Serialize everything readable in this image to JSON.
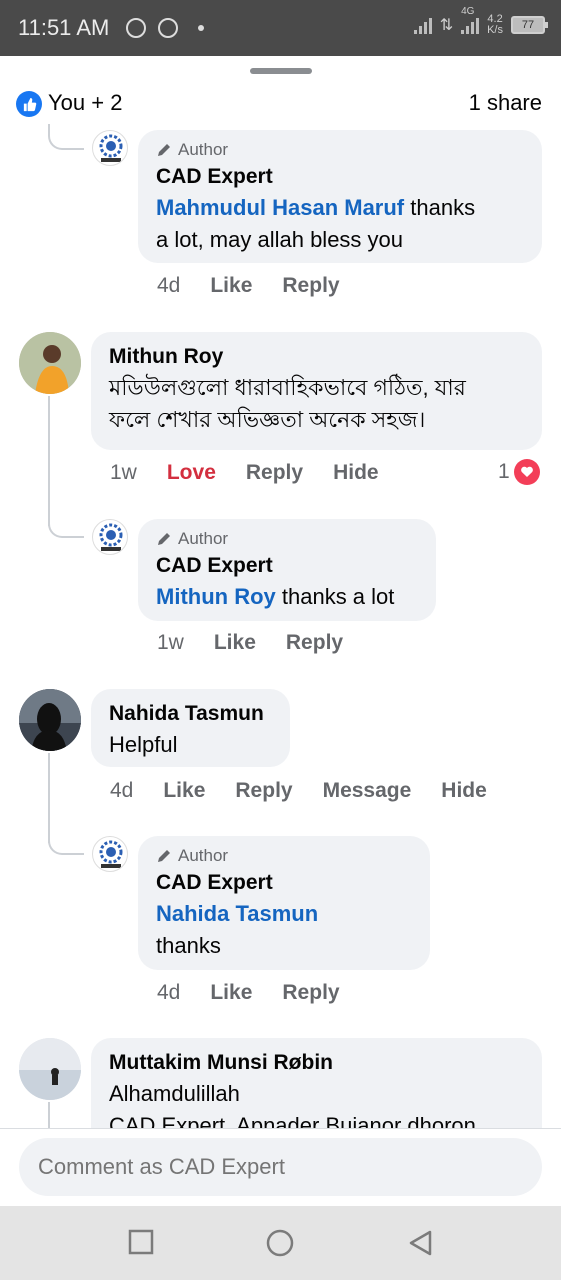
{
  "status_bar": {
    "time": "11:51 AM",
    "network": "4G",
    "speed_value": "4.2",
    "speed_unit": "K/s",
    "battery": "77"
  },
  "header": {
    "reactions_text": "You + 2",
    "shares_text": "1 share"
  },
  "comments": [
    {
      "author_label": "Author",
      "name": "CAD Expert",
      "tag": "Mahmudul Hasan Maruf",
      "text_line1": " thanks",
      "text_line2": "a lot, may allah bless you",
      "time": "4d",
      "like": "Like",
      "reply": "Reply"
    },
    {
      "name": "Mithun Roy",
      "text_line1": "মডিউলগুলো ধারাবাহিকভাবে গঠিত, যার",
      "text_line2": "ফলে শেখার অভিজ্ঞতা অনেক সহজ।",
      "time": "1w",
      "love": "Love",
      "reply": "Reply",
      "hide": "Hide",
      "reaction_count": "1"
    },
    {
      "author_label": "Author",
      "name": "CAD Expert",
      "tag": "Mithun Roy",
      "text": " thanks a lot",
      "time": "1w",
      "like": "Like",
      "reply": "Reply"
    },
    {
      "name": "Nahida Tasmun",
      "text": "Helpful",
      "time": "4d",
      "like": "Like",
      "reply": "Reply",
      "message": "Message",
      "hide": "Hide"
    },
    {
      "author_label": "Author",
      "name": "CAD Expert",
      "tag": "Nahida Tasmun",
      "text": "thanks",
      "time": "4d",
      "like": "Like",
      "reply": "Reply"
    },
    {
      "name": "Muttakim Munsi Røbin",
      "text_line1": "Alhamdulillah",
      "text_line2": "CAD Expert, Apnader Bujanor dhoron"
    }
  ],
  "composer": {
    "placeholder": "Comment as CAD Expert"
  },
  "colors": {
    "accent": "#1877f2",
    "tag": "#1565c0",
    "love": "#d32f3f"
  }
}
